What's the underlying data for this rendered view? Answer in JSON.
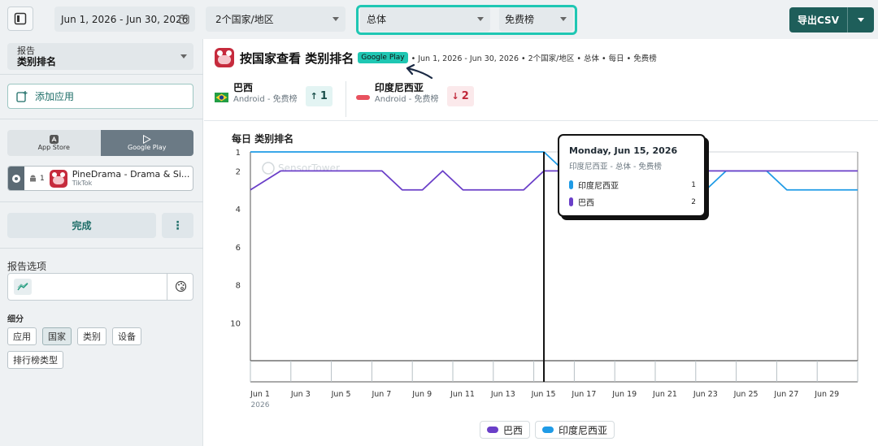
{
  "topbar": {
    "date_range": "Jun 1, 2026 - Jun 30, 2026",
    "countries": "2个国家/地区",
    "device": "总体",
    "chart_type": "免费榜",
    "export_label": "导出CSV"
  },
  "sidebar": {
    "report_label": "报告",
    "report_value": "类别排名",
    "add_app": "添加应用",
    "store_tabs": [
      {
        "label": "App Store",
        "active": false
      },
      {
        "label": "Google Play",
        "active": true
      }
    ],
    "app": {
      "rank": "1",
      "name": "PineDrama - Drama & Si...",
      "publisher": "TikTok"
    },
    "done": "完成",
    "options_title": "报告选项",
    "segment_title": "细分",
    "chips": [
      {
        "label": "应用",
        "selected": false
      },
      {
        "label": "国家",
        "selected": true
      },
      {
        "label": "类别",
        "selected": false
      },
      {
        "label": "设备",
        "selected": false
      },
      {
        "label": "排行榜类型",
        "selected": false
      }
    ]
  },
  "main": {
    "title": "按国家查看 类别排名",
    "store_badge": "Google Play",
    "meta": "• Jun 1, 2026 - Jun 30, 2026 • 2个国家/地区 • 总体 • 每日 • 免费榜",
    "countries": [
      {
        "name": "巴西",
        "sub": "Android - 免费榜",
        "delta": "1",
        "direction": "up"
      },
      {
        "name": "印度尼西亚",
        "sub": "Android - 免费榜",
        "delta": "2",
        "direction": "down"
      }
    ],
    "watermark": "SensorTower",
    "tooltip": {
      "date": "Monday, Jun 15, 2026",
      "sub": "印度尼西亚 - 总体 - 免费榜",
      "rows": [
        {
          "name": "印度尼西亚",
          "value": "1",
          "color": "#1f9be6"
        },
        {
          "name": "巴西",
          "value": "2",
          "color": "#6a3fc8"
        }
      ]
    }
  },
  "chart_data": {
    "type": "line",
    "title": "每日 类别排名",
    "ylim": [
      1,
      12
    ],
    "y_inverted": true,
    "yticks": [
      1,
      2,
      4,
      6,
      8,
      10
    ],
    "x": [
      "Jun 1",
      "Jun 2",
      "Jun 3",
      "Jun 4",
      "Jun 5",
      "Jun 6",
      "Jun 7",
      "Jun 8",
      "Jun 9",
      "Jun 10",
      "Jun 11",
      "Jun 12",
      "Jun 13",
      "Jun 14",
      "Jun 15",
      "Jun 16",
      "Jun 17",
      "Jun 18",
      "Jun 19",
      "Jun 20",
      "Jun 21",
      "Jun 22",
      "Jun 23",
      "Jun 24",
      "Jun 25",
      "Jun 26",
      "Jun 27",
      "Jun 28",
      "Jun 29",
      "Jun 30"
    ],
    "xtick_labels": [
      "Jun 1",
      "Jun 3",
      "Jun 5",
      "Jun 7",
      "Jun 9",
      "Jun 11",
      "Jun 13",
      "Jun 15",
      "Jun 17",
      "Jun 19",
      "Jun 21",
      "Jun 23",
      "Jun 25",
      "Jun 27",
      "Jun 29"
    ],
    "xtick_year": "2026",
    "series": [
      {
        "name": "巴西",
        "color": "#6a3fc8",
        "values": [
          3,
          2,
          2,
          2,
          2,
          2,
          2,
          3,
          3,
          2,
          3,
          3,
          3,
          3,
          2,
          2,
          2,
          2,
          2,
          2,
          2,
          2,
          2,
          2,
          2,
          2,
          2,
          2,
          2,
          2
        ]
      },
      {
        "name": "印度尼西亚",
        "color": "#1f9be6",
        "values": [
          1,
          1,
          1,
          1,
          1,
          1,
          1,
          1,
          1,
          1,
          1,
          1,
          1,
          1,
          1,
          2,
          2,
          2,
          2,
          2,
          2,
          2,
          3,
          2,
          2,
          2,
          3,
          3,
          3,
          3
        ]
      }
    ],
    "highlight_x": "Jun 15",
    "legend_position": "bottom"
  }
}
